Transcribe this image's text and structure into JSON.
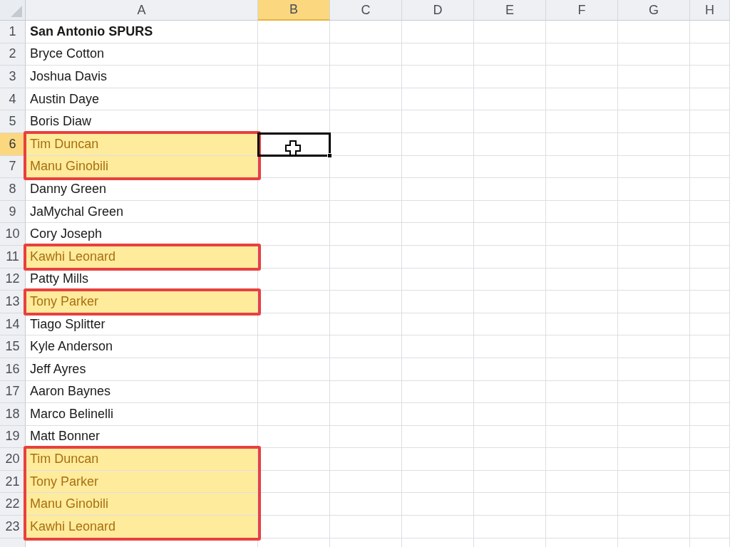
{
  "columns": [
    {
      "label": "A",
      "selected": false
    },
    {
      "label": "B",
      "selected": true
    },
    {
      "label": "C",
      "selected": false
    },
    {
      "label": "D",
      "selected": false
    },
    {
      "label": "E",
      "selected": false
    },
    {
      "label": "F",
      "selected": false
    },
    {
      "label": "G",
      "selected": false
    },
    {
      "label": "H",
      "selected": false
    }
  ],
  "rows": [
    {
      "number": "1",
      "value": "San Antonio SPURS",
      "bold": true,
      "duplicate": false,
      "selected": false
    },
    {
      "number": "2",
      "value": "Bryce Cotton",
      "bold": false,
      "duplicate": false,
      "selected": false
    },
    {
      "number": "3",
      "value": "Joshua Davis",
      "bold": false,
      "duplicate": false,
      "selected": false
    },
    {
      "number": "4",
      "value": "Austin Daye",
      "bold": false,
      "duplicate": false,
      "selected": false
    },
    {
      "number": "5",
      "value": "Boris Diaw",
      "bold": false,
      "duplicate": false,
      "selected": false
    },
    {
      "number": "6",
      "value": "Tim Duncan",
      "bold": false,
      "duplicate": true,
      "selected": true
    },
    {
      "number": "7",
      "value": "Manu Ginobili",
      "bold": false,
      "duplicate": true,
      "selected": false
    },
    {
      "number": "8",
      "value": "Danny Green",
      "bold": false,
      "duplicate": false,
      "selected": false
    },
    {
      "number": "9",
      "value": "JaMychal Green",
      "bold": false,
      "duplicate": false,
      "selected": false
    },
    {
      "number": "10",
      "value": "Cory Joseph",
      "bold": false,
      "duplicate": false,
      "selected": false
    },
    {
      "number": "11",
      "value": "Kawhi Leonard",
      "bold": false,
      "duplicate": true,
      "selected": false
    },
    {
      "number": "12",
      "value": "Patty Mills",
      "bold": false,
      "duplicate": false,
      "selected": false
    },
    {
      "number": "13",
      "value": "Tony Parker",
      "bold": false,
      "duplicate": true,
      "selected": false
    },
    {
      "number": "14",
      "value": "Tiago Splitter",
      "bold": false,
      "duplicate": false,
      "selected": false
    },
    {
      "number": "15",
      "value": "Kyle Anderson",
      "bold": false,
      "duplicate": false,
      "selected": false
    },
    {
      "number": "16",
      "value": "Jeff Ayres",
      "bold": false,
      "duplicate": false,
      "selected": false
    },
    {
      "number": "17",
      "value": "Aaron Baynes",
      "bold": false,
      "duplicate": false,
      "selected": false
    },
    {
      "number": "18",
      "value": "Marco Belinelli",
      "bold": false,
      "duplicate": false,
      "selected": false
    },
    {
      "number": "19",
      "value": "Matt Bonner",
      "bold": false,
      "duplicate": false,
      "selected": false
    },
    {
      "number": "20",
      "value": "Tim Duncan",
      "bold": false,
      "duplicate": true,
      "selected": false
    },
    {
      "number": "21",
      "value": "Tony Parker",
      "bold": false,
      "duplicate": true,
      "selected": false
    },
    {
      "number": "22",
      "value": "Manu Ginobili",
      "bold": false,
      "duplicate": true,
      "selected": false
    },
    {
      "number": "23",
      "value": "Kawhi Leonard",
      "bold": false,
      "duplicate": true,
      "selected": false
    }
  ]
}
